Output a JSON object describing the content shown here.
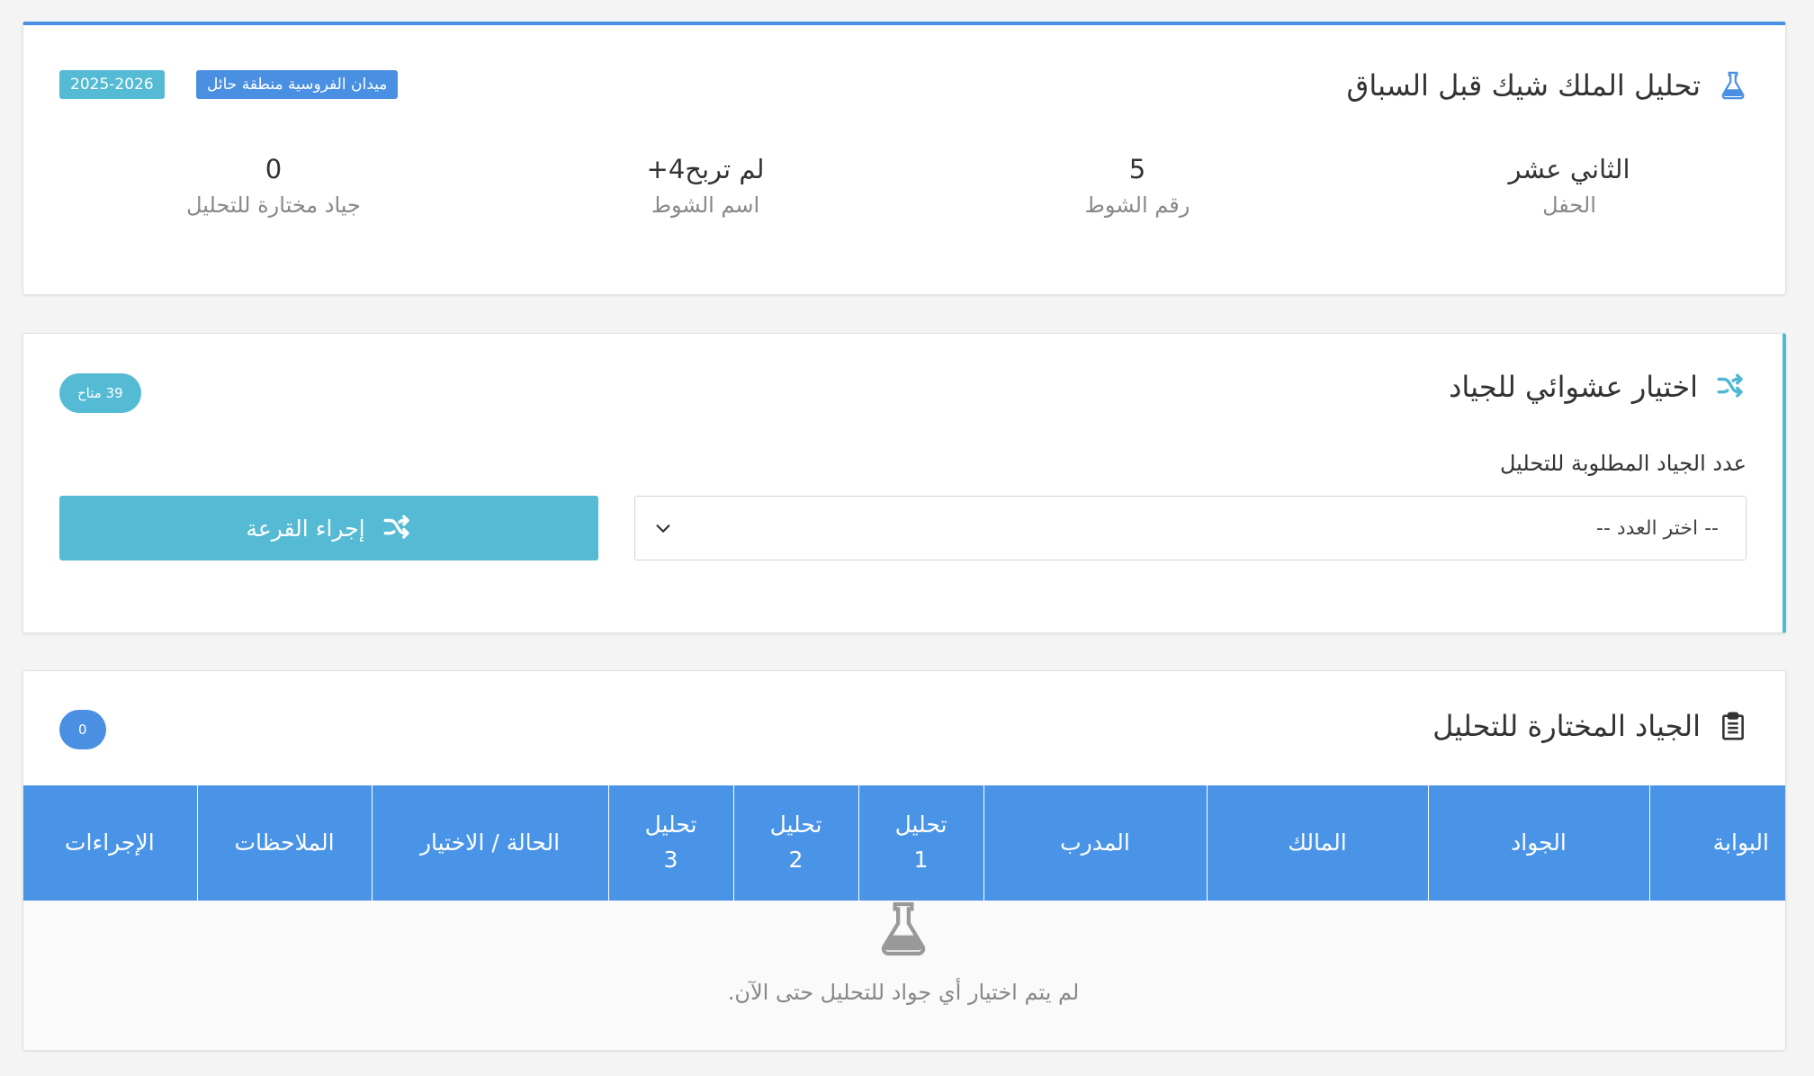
{
  "analysis_card": {
    "title": "تحليل الملك شيك قبل السباق",
    "venue_badge": "ميدان الفروسية منطقة حائل",
    "season_badge": "2025-2026",
    "stats": [
      {
        "value": "الثاني عشر",
        "label": "الحفل"
      },
      {
        "value": "5",
        "label": "رقم الشوط"
      },
      {
        "value": "لم تربح4+",
        "label": "اسم الشوط"
      },
      {
        "value": "0",
        "label": "جياد مختارة للتحليل"
      }
    ]
  },
  "random_card": {
    "title": "اختيار عشوائي للجياد",
    "available_badge": "39 متاح",
    "field_label": "عدد الجياد المطلوبة للتحليل",
    "select_value": "-- اختر العدد --",
    "draw_button": "إجراء القرعة"
  },
  "selected_card": {
    "title": "الجياد المختارة للتحليل",
    "count_badge": "0",
    "columns": [
      "البوابة",
      "الجواد",
      "المالك",
      "المدرب",
      "تحليل 1",
      "تحليل 2",
      "تحليل 3",
      "الحالة / الاختيار",
      "الملاحظات",
      "الإجراءات"
    ],
    "empty_message": "لم يتم اختيار أي جواد للتحليل حتى الآن."
  },
  "colors": {
    "primary": "#4a90e2",
    "info": "#55bad3",
    "header_blue": "#4a94e8",
    "muted_text": "#888888"
  },
  "icons": {
    "analysis": "flask-icon",
    "random": "shuffle-icon",
    "selected": "clipboard-icon",
    "select_caret": "chevron-down-icon"
  }
}
